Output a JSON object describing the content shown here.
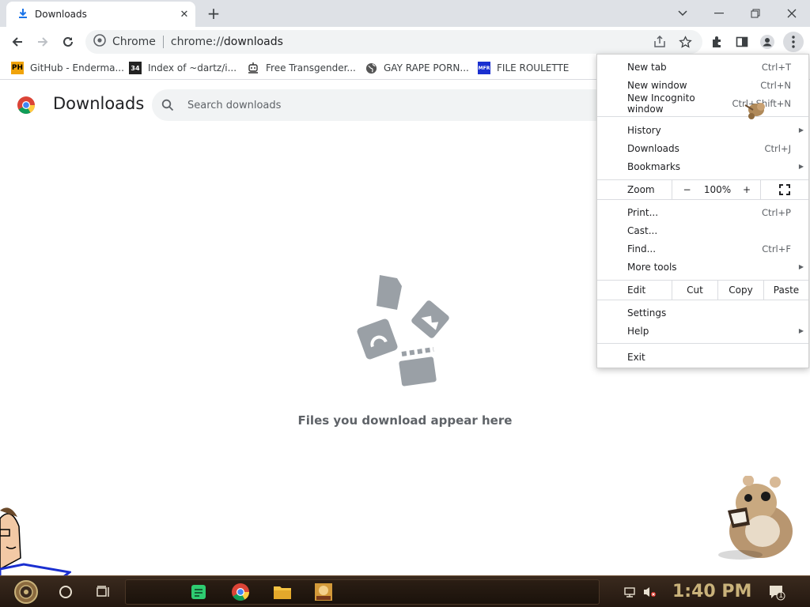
{
  "tab": {
    "title": "Downloads",
    "icon": "download-icon"
  },
  "window_controls": {
    "search": "chevron-down-icon",
    "minimize": "minimize-icon",
    "restore": "restore-icon",
    "close": "close-icon"
  },
  "omnibox": {
    "site_label": "Chrome",
    "url_prefix": "chrome://",
    "url_host": "downloads"
  },
  "bookmarks": [
    {
      "label": "GitHub - Enderma...",
      "icon": "PH",
      "color": "#f0a30a"
    },
    {
      "label": "Index of ~dartz/i...",
      "icon": "34",
      "color": "#222222"
    },
    {
      "label": "Free Transgender...",
      "icon": "robot",
      "color": "#444444"
    },
    {
      "label": "GAY RAPE PORN...",
      "icon": "globe",
      "color": "#555555"
    },
    {
      "label": "FILE ROULETTE",
      "icon": "MFR",
      "color": "#1a2fd0"
    }
  ],
  "page": {
    "title": "Downloads",
    "search_placeholder": "Search downloads",
    "empty_message": "Files you download appear here"
  },
  "menu": {
    "new_tab": {
      "label": "New tab",
      "shortcut": "Ctrl+T"
    },
    "new_window": {
      "label": "New window",
      "shortcut": "Ctrl+N"
    },
    "new_incognito": {
      "label": "New Incognito window",
      "shortcut": "Ctrl+Shift+N"
    },
    "history": {
      "label": "History"
    },
    "downloads": {
      "label": "Downloads",
      "shortcut": "Ctrl+J"
    },
    "bookmarks": {
      "label": "Bookmarks"
    },
    "zoom": {
      "label": "Zoom",
      "minus": "−",
      "level": "100%",
      "plus": "+"
    },
    "print": {
      "label": "Print...",
      "shortcut": "Ctrl+P"
    },
    "cast": {
      "label": "Cast..."
    },
    "find": {
      "label": "Find...",
      "shortcut": "Ctrl+F"
    },
    "more_tools": {
      "label": "More tools"
    },
    "edit": {
      "label": "Edit",
      "cut": "Cut",
      "copy": "Copy",
      "paste": "Paste"
    },
    "settings": {
      "label": "Settings"
    },
    "help": {
      "label": "Help"
    },
    "exit": {
      "label": "Exit"
    }
  },
  "taskbar": {
    "clock": "1:40 PM",
    "notification_count": "1",
    "accent": "#c9b27a"
  }
}
